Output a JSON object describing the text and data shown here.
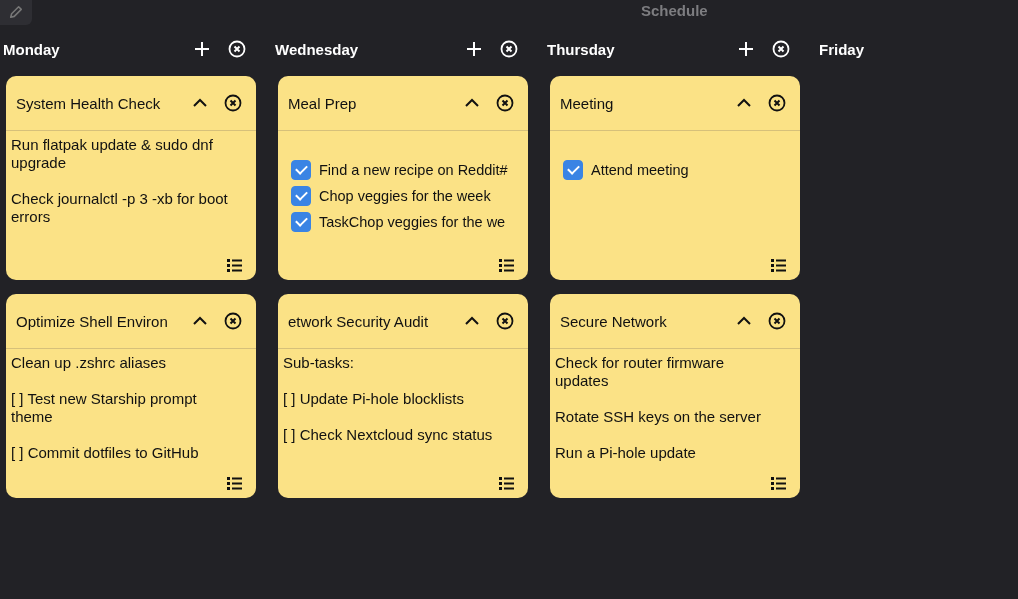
{
  "title": "Schedule",
  "columns": [
    {
      "day": "Monday",
      "cards": [
        {
          "title": "System Health Check",
          "kind": "text",
          "lines": [
            "Run flatpak update & sudo dnf upgrade",
            "Check journalctl -p 3 -xb for boot errors"
          ]
        },
        {
          "title": "Optimize Shell Environ",
          "kind": "text",
          "lines": [
            "Clean up .zshrc aliases",
            "[ ] Test new Starship prompt theme",
            "[ ] Commit dotfiles to GitHub"
          ]
        }
      ]
    },
    {
      "day": "Wednesday",
      "cards": [
        {
          "title": "Meal Prep",
          "kind": "checklist",
          "items": [
            {
              "label": "Find a new recipe on Reddit#",
              "checked": true
            },
            {
              "label": "Chop veggies for the week",
              "checked": true
            },
            {
              "label": "TaskChop veggies for the we",
              "checked": true
            }
          ]
        },
        {
          "title": "etwork Security Audit",
          "kind": "text",
          "lines": [
            "Sub-tasks:",
            "[ ] Update Pi-hole blocklists",
            "[ ] Check Nextcloud sync status"
          ]
        }
      ]
    },
    {
      "day": "Thursday",
      "cards": [
        {
          "title": "Meeting",
          "kind": "checklist",
          "items": [
            {
              "label": "Attend meeting",
              "checked": true
            }
          ]
        },
        {
          "title": "Secure Network",
          "kind": "text",
          "lines": [
            "Check for router firmware updates",
            "Rotate SSH keys on the server",
            "Run a Pi-hole update"
          ]
        }
      ]
    },
    {
      "day": "Friday"
    }
  ]
}
